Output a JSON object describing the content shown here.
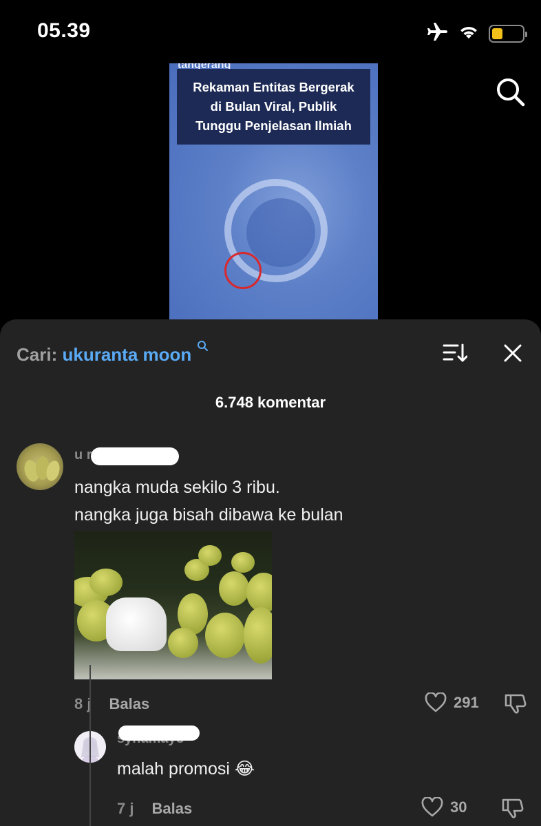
{
  "status": {
    "time": "05.39",
    "battery_level": 0.35,
    "battery_color": "#f2c21b"
  },
  "video": {
    "source": "tangerang",
    "headline": "Rekaman Entitas Bergerak\ndi Bulan Viral, Publik\nTunggu Penjelasan Ilmiah"
  },
  "search": {
    "prefix": "Cari:",
    "query": "ukuranta moon"
  },
  "comment_count": "6.748 komentar",
  "comments": [
    {
      "username": "u                    rem",
      "text": "nangka muda sekilo 3 ribu.\nnangka juga bisah dibawa ke bulan",
      "time": "8 j",
      "reply_label": "Balas",
      "likes": "291"
    },
    {
      "username": "syhamayo",
      "text": "malah promosi 😂",
      "time": "7 j",
      "reply_label": "Balas",
      "likes": "30"
    }
  ],
  "colors": {
    "accent": "#5aaaf5",
    "sheet_bg": "#232323"
  }
}
